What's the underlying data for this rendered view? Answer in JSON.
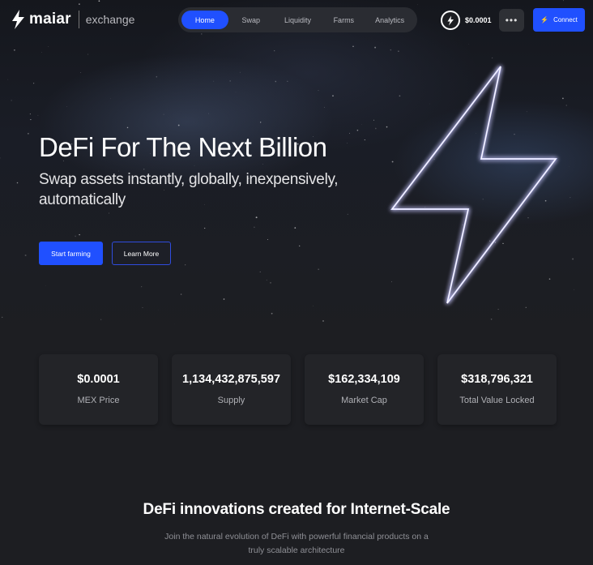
{
  "brand": {
    "name": "maiar",
    "product": "exchange"
  },
  "nav": {
    "items": [
      {
        "label": "Home",
        "active": true
      },
      {
        "label": "Swap",
        "active": false
      },
      {
        "label": "Liquidity",
        "active": false
      },
      {
        "label": "Farms",
        "active": false
      },
      {
        "label": "Analytics",
        "active": false
      }
    ]
  },
  "header": {
    "mex_price": "$0.0001",
    "more_label": "•••",
    "connect_label": "Connect"
  },
  "hero": {
    "title": "DeFi For The Next Billion",
    "subtitle": "Swap assets instantly, globally, inexpensively, automatically",
    "primary_cta": "Start farming",
    "secondary_cta": "Learn More"
  },
  "stats": [
    {
      "value": "$0.0001",
      "label": "MEX Price"
    },
    {
      "value": "1,134,432,875,597",
      "label": "Supply"
    },
    {
      "value": "$162,334,109",
      "label": "Market Cap"
    },
    {
      "value": "$318,796,321",
      "label": "Total Value Locked"
    }
  ],
  "section": {
    "title": "DeFi innovations created for Internet-Scale",
    "subtitle": "Join the natural evolution of DeFi with powerful financial products on a truly scalable architecture"
  },
  "colors": {
    "accent": "#2050ff",
    "background": "#1d1e22",
    "card": "#232428"
  }
}
